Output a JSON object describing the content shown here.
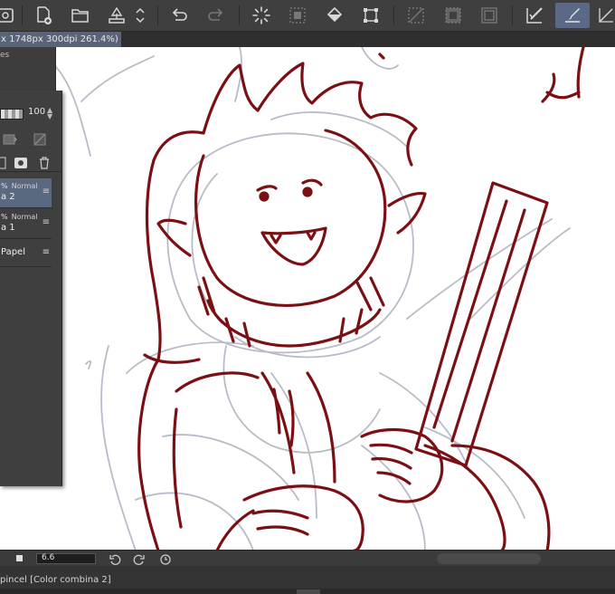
{
  "toolbar": {
    "buttons": [
      {
        "name": "new-canvas",
        "icon": "new-document-icon"
      },
      {
        "name": "open-file",
        "icon": "folder-icon"
      },
      {
        "name": "export",
        "icon": "export-tray-icon"
      },
      {
        "name": "undo",
        "icon": "undo-icon"
      },
      {
        "name": "redo",
        "icon": "redo-icon"
      },
      {
        "name": "loading",
        "icon": "spinner-icon"
      },
      {
        "name": "clear",
        "icon": "clear-selection-icon"
      },
      {
        "name": "fill",
        "icon": "paint-bucket-icon"
      },
      {
        "name": "transform",
        "icon": "transform-icon"
      },
      {
        "name": "deselect",
        "icon": "deselect-icon"
      },
      {
        "name": "invert-selection",
        "icon": "invert-selection-icon"
      },
      {
        "name": "selection-border",
        "icon": "selection-border-icon"
      },
      {
        "name": "vector-edit",
        "icon": "check-brush-icon"
      },
      {
        "name": "brush-tool",
        "icon": "brush-icon",
        "active": true
      }
    ],
    "active_color": "#5a6a86"
  },
  "document_tab": {
    "label": "x 1748px 300dpi 261.4%)"
  },
  "layer_panel": {
    "top_label": "es",
    "opacity_value": "100",
    "layers": [
      {
        "opacity": "%",
        "mode": "Normal",
        "name": "a 2",
        "selected": true
      },
      {
        "opacity": "%",
        "mode": "Normal",
        "name": "a 1",
        "selected": false
      }
    ],
    "paper_layer": "Papel"
  },
  "status_bar": {
    "brush_size": "6.6"
  },
  "footer": {
    "text": "pincel [Color combina 2]"
  },
  "colors": {
    "sketch_stroke": "#7a0f14",
    "rough_stroke": "#b8bcc8",
    "selected_layer": "#5a6880"
  }
}
